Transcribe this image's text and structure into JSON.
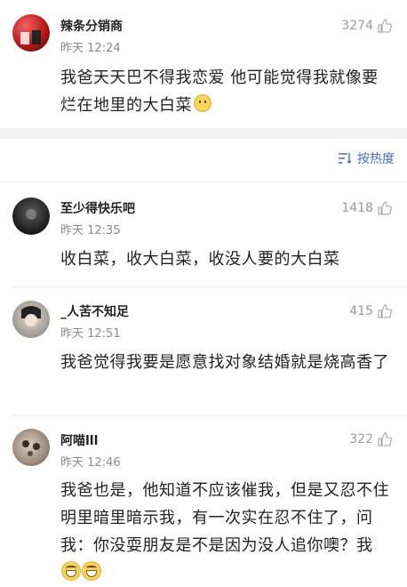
{
  "comments": [
    {
      "name": "辣条分销商",
      "time": "昨天 12:24",
      "likes": "3274",
      "text": "我爸天天巴不得我恋爱 他可能觉得我就像要烂在地里的大白菜",
      "emoji": "smile-emoji"
    },
    {
      "name": "至少得快乐吧",
      "time": "昨天 12:35",
      "likes": "1418",
      "text": "收白菜，收大白菜，收没人要的大白菜"
    },
    {
      "name": "_人苦不知足",
      "time": "昨天 12:51",
      "likes": "415",
      "text": "我爸觉得我要是愿意找对象结婚就是烧高香了"
    },
    {
      "name": "阿喵lll",
      "time": "昨天 12:46",
      "likes": "322",
      "text": "我爸也是，他知道不应该催我，但是又忍不住明里暗里暗示我，有一次实在忍不住了，问我：你没耍朋友是不是因为没人追你噢？我",
      "emoji": "grin-emoji"
    }
  ],
  "sort": {
    "label": "按热度",
    "icon": "sort-icon"
  },
  "colors": {
    "link": "#4a6ea9",
    "muted": "#8a8a8a",
    "separator": "#f2f2f2"
  }
}
